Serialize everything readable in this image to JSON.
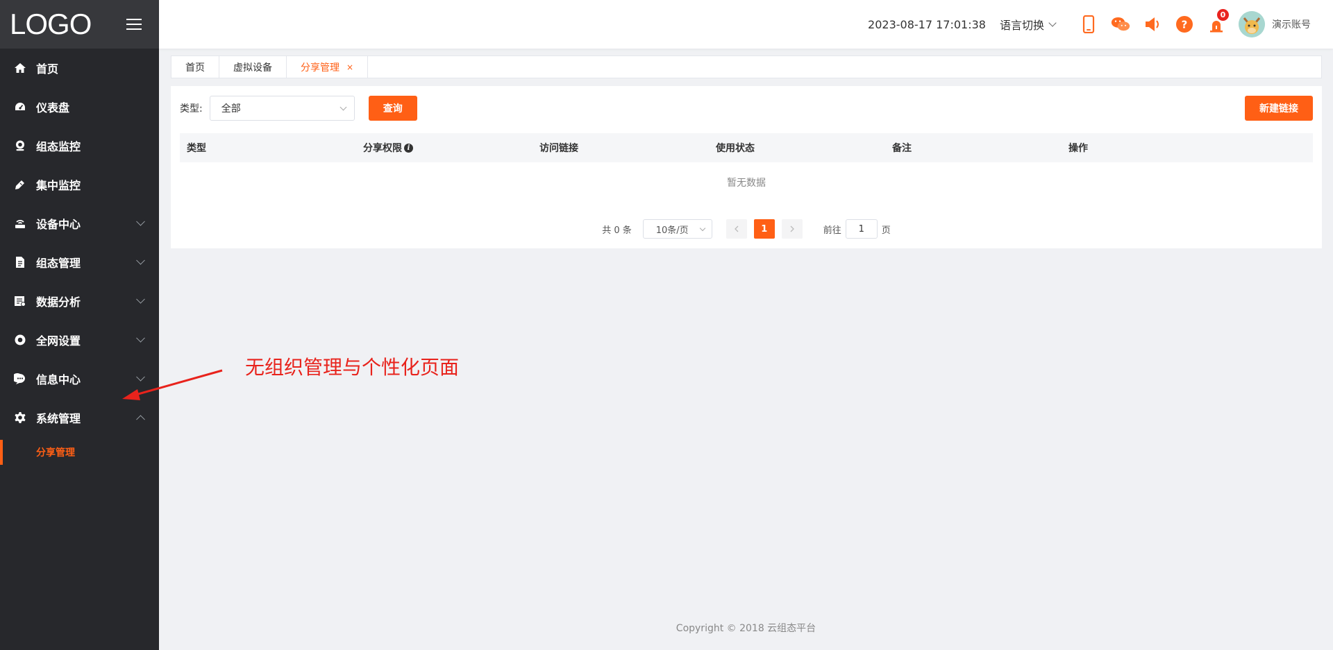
{
  "app": {
    "logo": "LOGO"
  },
  "sidebar": {
    "items": [
      {
        "label": "首页",
        "icon": "home-icon"
      },
      {
        "label": "仪表盘",
        "icon": "dashboard-icon"
      },
      {
        "label": "组态监控",
        "icon": "camera-icon"
      },
      {
        "label": "集中监控",
        "icon": "pen-icon"
      },
      {
        "label": "设备中心",
        "icon": "router-icon",
        "expandable": true
      },
      {
        "label": "组态管理",
        "icon": "file-icon",
        "expandable": true
      },
      {
        "label": "数据分析",
        "icon": "report-icon",
        "expandable": true
      },
      {
        "label": "全网设置",
        "icon": "circle-icon",
        "expandable": true
      },
      {
        "label": "信息中心",
        "icon": "chat-icon",
        "expandable": true
      },
      {
        "label": "系统管理",
        "icon": "gear-icon",
        "expandable": true,
        "expanded": true
      }
    ],
    "submenu": {
      "label": "分享管理"
    }
  },
  "header": {
    "datetime": "2023-08-17 17:01:38",
    "language": "语言切换",
    "notification_count": "0",
    "username": "演示账号"
  },
  "tabs": [
    {
      "label": "首页"
    },
    {
      "label": "虚拟设备"
    },
    {
      "label": "分享管理",
      "active": true,
      "close": "×"
    }
  ],
  "filter": {
    "type_label": "类型:",
    "type_value": "全部",
    "query_button": "查询",
    "new_link_button": "新建链接"
  },
  "table": {
    "columns": [
      "类型",
      "分享权限",
      "访问链接",
      "使用状态",
      "备注",
      "操作"
    ],
    "empty_text": "暂无数据"
  },
  "pagination": {
    "total": "共 0 条",
    "page_size": "10条/页",
    "current_page": "1",
    "goto_label": "前往",
    "goto_value": "1",
    "page_suffix": "页"
  },
  "annotation": {
    "text": "无组织管理与个性化页面"
  },
  "footer": {
    "copyright": "Copyright © 2018 云组态平台"
  },
  "colors": {
    "accent": "#ff5f15",
    "sidebar": "#27282c",
    "annotation": "#e8231c"
  }
}
